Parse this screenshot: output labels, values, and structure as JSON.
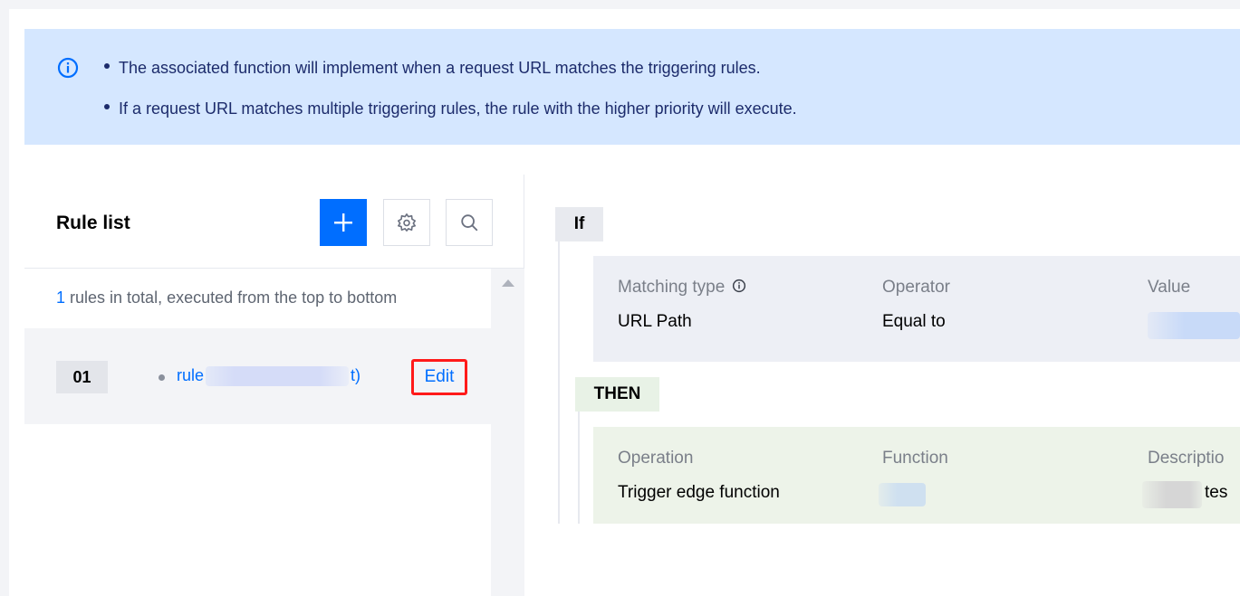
{
  "notice": {
    "icon": "info-circle-icon",
    "accent": "#006eff",
    "lines": [
      "The associated function will implement when a request URL matches the triggering rules.",
      "If a request URL matches multiple triggering rules, the rule with the higher priority will execute."
    ]
  },
  "left_panel": {
    "title": "Rule list",
    "toolbar": {
      "add_icon": "plus-icon",
      "settings_icon": "gear-icon",
      "search_icon": "search-icon"
    },
    "summary": {
      "count": "1",
      "text": " rules in total, executed from the top to bottom"
    },
    "rules": [
      {
        "index": "01",
        "name_prefix": "rule",
        "name_suffix": "t)",
        "edit_label": "Edit"
      }
    ]
  },
  "right_panel": {
    "if_label": "If",
    "then_label": "THEN",
    "condition": {
      "headers": [
        "Matching type",
        "Operator",
        "Value"
      ],
      "values": [
        "URL Path",
        "Equal to",
        ""
      ]
    },
    "action": {
      "headers": [
        "Operation",
        "Function",
        "Descriptio"
      ],
      "values": [
        "Trigger edge function",
        "",
        "tes"
      ]
    }
  },
  "colors": {
    "primary": "#006eff",
    "notice_bg": "#d5e7ff",
    "highlight_border": "#ff1a1a"
  }
}
